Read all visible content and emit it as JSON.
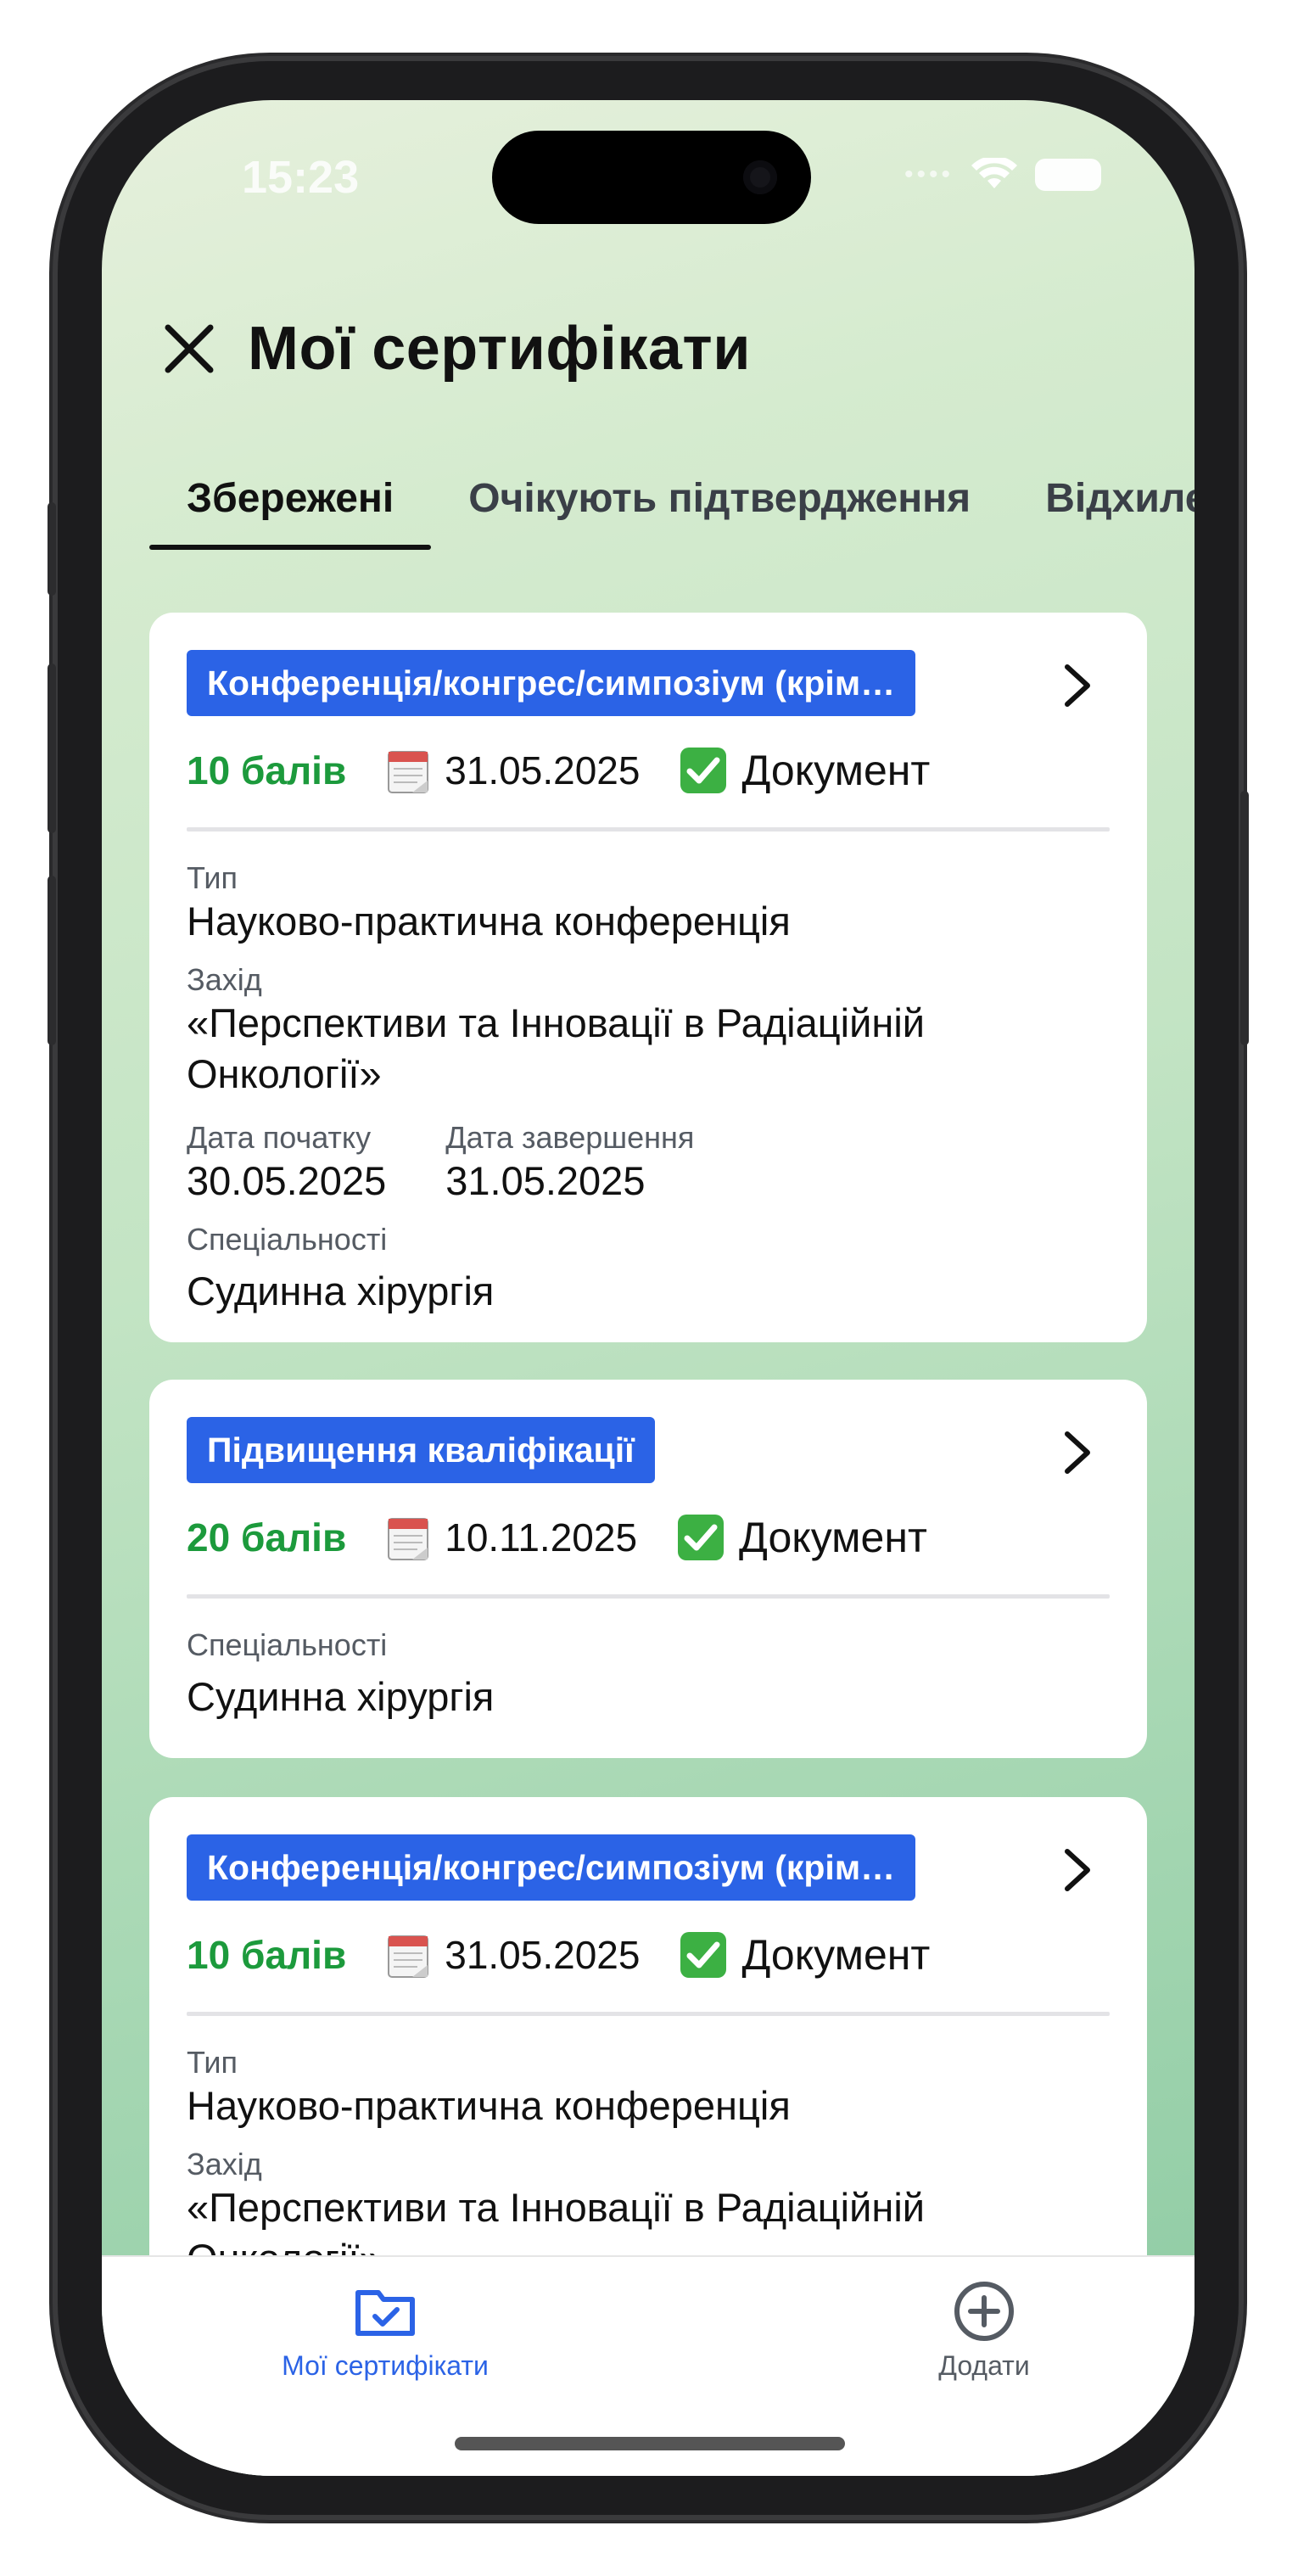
{
  "status_bar": {
    "time": "15:23"
  },
  "header": {
    "title": "Мої сертифікати"
  },
  "tabs": [
    {
      "label": "Збережені"
    },
    {
      "label": "Очікують підтвердження"
    },
    {
      "label": "Відхилені"
    }
  ],
  "cards": [
    {
      "tag": "Конференція/конгрес/симпозіум (крім…",
      "points": "10 балів",
      "date": "31.05.2025",
      "document": "Документ",
      "type_label": "Тип",
      "type_value": "Науково-практична конференція",
      "event_label": "Захід",
      "event_value": "«Перспективи та Інновації в Радіаційній Онкології»",
      "start_label": "Дата початку",
      "start_value": "30.05.2025",
      "end_label": "Дата завершення",
      "end_value": "31.05.2025",
      "spec_label": "Спеціальності",
      "spec_value": "Судинна хірургія"
    },
    {
      "tag": "Підвищення кваліфікації",
      "points": "20 балів",
      "date": "10.11.2025",
      "document": "Документ",
      "spec_label": "Спеціальності",
      "spec_value": "Судинна хірургія"
    },
    {
      "tag": "Конференція/конгрес/симпозіум (крім…",
      "points": "10 балів",
      "date": "31.05.2025",
      "document": "Документ",
      "type_label": "Тип",
      "type_value": "Науково-практична конференція",
      "event_label": "Захід",
      "event_value": "«Перспективи та Інновації в Радіаційній Онкології»"
    }
  ],
  "bottom_nav": [
    {
      "label": "Мої сертифікати",
      "icon": "folder-check-icon",
      "active": true,
      "color": "#2b63e6"
    },
    {
      "label": "Додати",
      "icon": "plus-circle-icon",
      "active": false,
      "color": "#555b63"
    }
  ],
  "colors": {
    "accent": "#2b63e6",
    "points": "#1c9a3c"
  }
}
